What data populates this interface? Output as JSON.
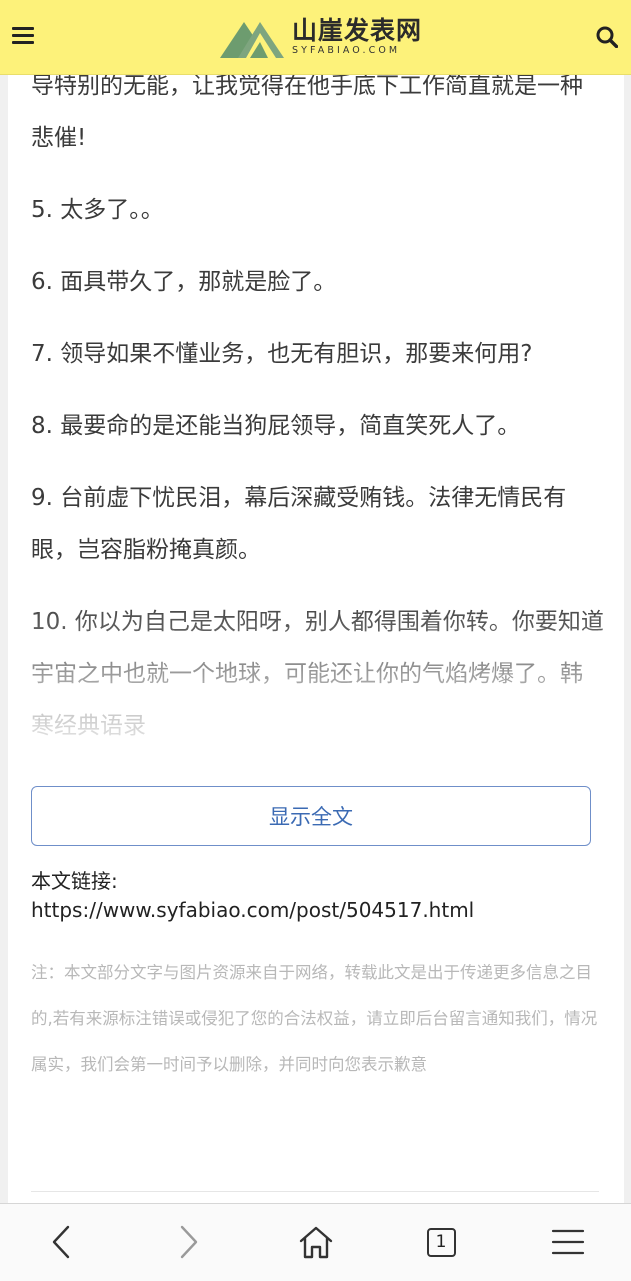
{
  "header": {
    "logo_cn": "山崖发表网",
    "logo_en": "SYFABIAO.COM",
    "menu_icon": "hamburger-menu-icon",
    "search_icon": "search-icon",
    "colors": {
      "bar_bg": "#fdf27a",
      "logo_green": "#6d9c6f"
    }
  },
  "article": {
    "paragraphs": [
      "导特别的无能，让我觉得在他手底下工作简直就是一种悲催!",
      "5. 太多了。。",
      "6. 面具带久了，那就是脸了。",
      "7. 领导如果不懂业务，也无有胆识，那要来何用?",
      "8. 最要命的是还能当狗屁领导，简直笑死人了。",
      "9. 台前虚下忧民泪，幕后深藏受贿钱。法律无情民有眼，岂容脂粉掩真颜。",
      "10. 你以为自己是太阳呀，别人都得围着你转。你要知道宇宙之中也就一个地球，可能还让你的气焰烤爆了。韩寒经典语录"
    ],
    "show_all_label": "显示全文",
    "link_label": "本文链接:",
    "link_url": "https://www.syfabiao.com/post/504517.html",
    "note": "注：本文部分文字与图片资源来自于网络，转载此文是出于传递更多信息之目的,若有来源标注错误或侵犯了您的合法权益，请立即后台留言通知我们，情况属实，我们会第一时间予以删除，并同时向您表示歉意"
  },
  "browser_nav": {
    "back_icon": "back-arrow-icon",
    "forward_icon": "forward-arrow-icon",
    "home_icon": "home-icon",
    "tab_count": "1",
    "menu_icon": "menu-lines-icon"
  }
}
